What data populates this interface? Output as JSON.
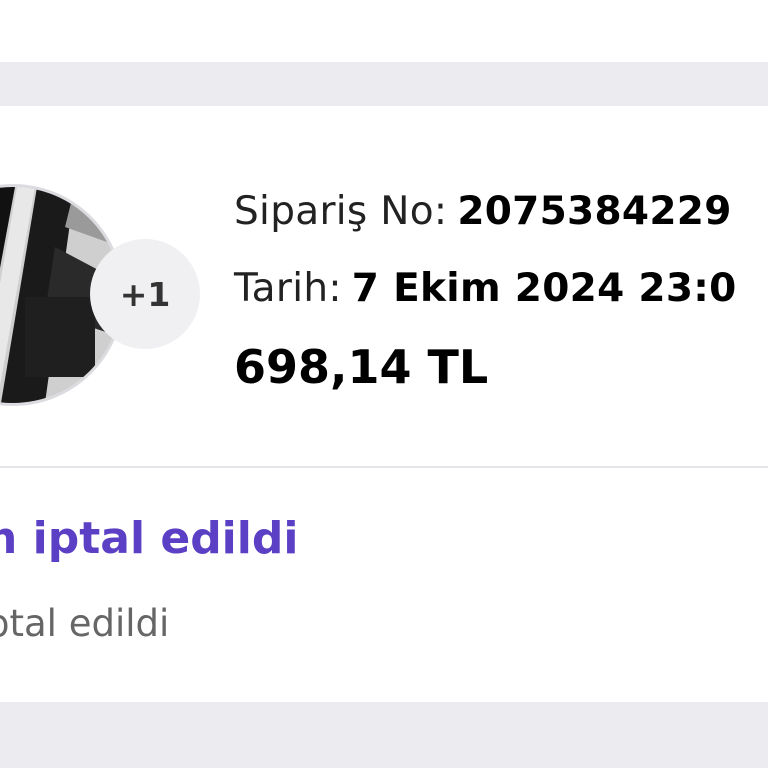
{
  "order": {
    "number_label": "Sipariş No:",
    "number_value": "2075384229",
    "date_label": "Tarih:",
    "date_value": "7 Ekim 2024 23:0",
    "price": "698,14 TL",
    "extra_items_badge": "+1"
  },
  "status": {
    "title": "n iptal edildi",
    "subtitle": "ptal edildi"
  },
  "colors": {
    "accent": "#5b3fc4",
    "band": "#ebebf0",
    "divider": "#e6e6ea"
  },
  "icons": {
    "product_thumbnail": "product-photo"
  }
}
